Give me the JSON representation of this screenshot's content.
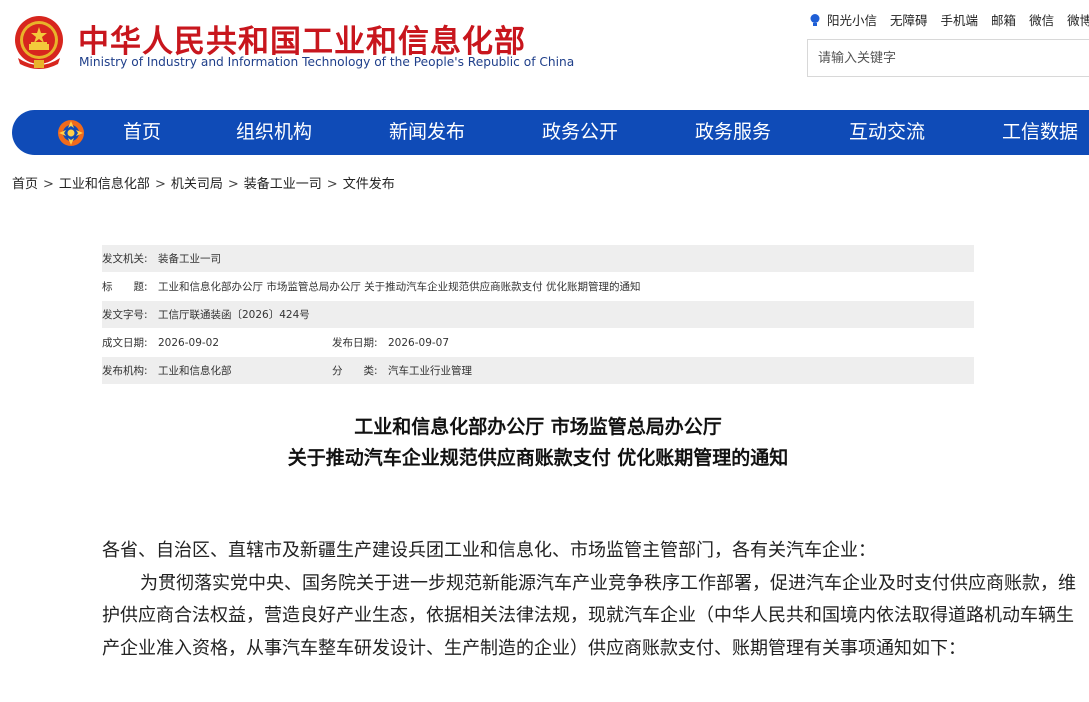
{
  "header": {
    "title": "中华人民共和国工业和信息化部",
    "subtitle": "Ministry of Industry and Information Technology of the People's Republic of China",
    "top_links": [
      "阳光小信",
      "无障碍",
      "手机端",
      "邮箱",
      "微信",
      "微博"
    ],
    "search_placeholder": "请输入关键字"
  },
  "nav": {
    "items": [
      "首页",
      "组织机构",
      "新闻发布",
      "政务公开",
      "政务服务",
      "互动交流",
      "工信数据"
    ]
  },
  "breadcrumb": [
    "首页",
    "工业和信息化部",
    "机关司局",
    "装备工业一司",
    "文件发布"
  ],
  "meta": {
    "issuer_label": "发文机关:",
    "issuer": "装备工业一司",
    "title_label": "标　　题:",
    "title": "工业和信息化部办公厅 市场监管总局办公厅 关于推动汽车企业规范供应商账款支付 优化账期管理的通知",
    "doc_no_label": "发文字号:",
    "doc_no": "工信厅联通装函〔2026〕424号",
    "written_label": "成文日期:",
    "written": "2026-09-02",
    "published_label": "发布日期:",
    "published": "2026-09-07",
    "org_label": "发布机构:",
    "org": "工业和信息化部",
    "category_label": "分　　类:",
    "category": "汽车工业行业管理"
  },
  "document": {
    "title_line1": "工业和信息化部办公厅 市场监管总局办公厅",
    "title_line2": "关于推动汽车企业规范供应商账款支付 优化账期管理的通知",
    "salutation": "各省、自治区、直辖市及新疆生产建设兵团工业和信息化、市场监管主管部门，各有关汽车企业：",
    "paragraph1": "为贯彻落实党中央、国务院关于进一步规范新能源汽车产业竞争秩序工作部署，促进汽车企业及时支付供应商账款，维护供应商合法权益，营造良好产业生态，依据相关法律法规，现就汽车企业（中华人民共和国境内依法取得道路机动车辆生产企业准入资格，从事汽车整车研发设计、生产制造的企业）供应商账款支付、账期管理有关事项通知如下："
  },
  "colors": {
    "brand_red": "#c8161d",
    "nav_blue": "#0f4bb7",
    "subtitle_blue": "#1f3f8a"
  }
}
